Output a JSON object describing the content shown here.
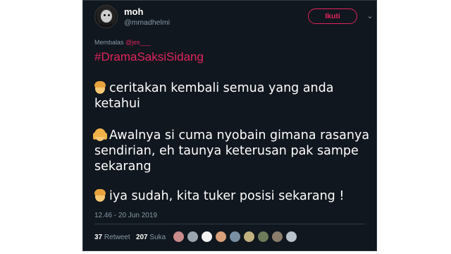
{
  "tweet": {
    "display_name": "moh",
    "handle": "@mmadhelmi",
    "follow_label": "Ikuti",
    "reply_prefix": "Membalas",
    "reply_mention": "@jes___",
    "hashtag": "#DramaSaksiSidang",
    "paragraphs": [
      {
        "emoji": "boy-emoji",
        "text": "ceritakan kembali semua yang anda ketahui"
      },
      {
        "emoji": "girl-emoji",
        "text": "Awalnya si cuma nyobain gimana rasanya sendirian, eh taunya keterusan pak sampe sekarang"
      },
      {
        "emoji": "boy-emoji",
        "text": "iya sudah, kita tuker posisi sekarang !"
      }
    ],
    "timestamp": "12.46 - 20 Jun 2019",
    "retweet_count": "37",
    "retweet_label": "Retweet",
    "like_count": "207",
    "like_label": "Suka"
  },
  "colors": {
    "background": "#10171e",
    "accent": "#e0245e",
    "muted": "#8899a6",
    "text": "#ffffff"
  },
  "liker_avatars": [
    {
      "name": "liker-avatar",
      "color": "#c98b8b"
    },
    {
      "name": "liker-avatar",
      "color": "#9aa5b0"
    },
    {
      "name": "liker-avatar",
      "color": "#f2f2f2"
    },
    {
      "name": "liker-avatar",
      "color": "#d9a07a"
    },
    {
      "name": "liker-avatar",
      "color": "#7a8fa3"
    },
    {
      "name": "liker-avatar",
      "color": "#c2b280"
    },
    {
      "name": "liker-avatar",
      "color": "#6d7b5a"
    },
    {
      "name": "liker-avatar",
      "color": "#8a7d6b"
    },
    {
      "name": "liker-avatar",
      "color": "#b9c3cc"
    }
  ]
}
